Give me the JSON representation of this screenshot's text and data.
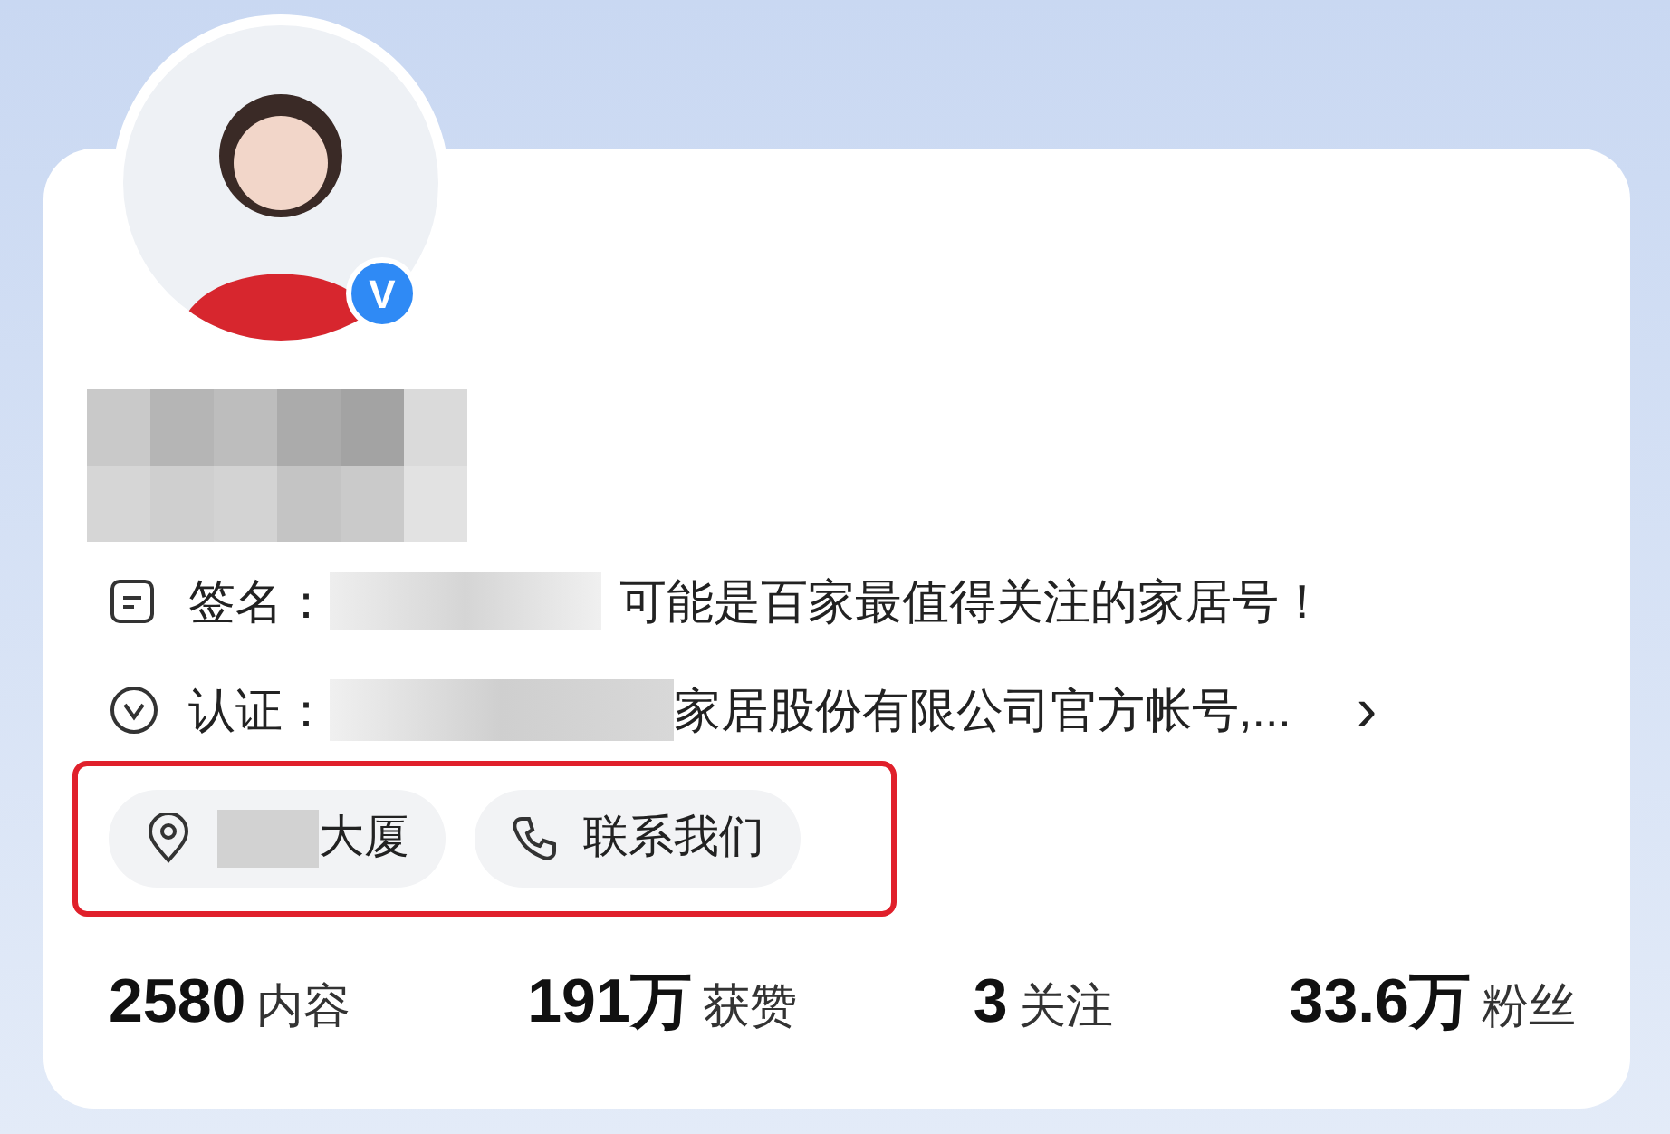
{
  "avatar": {
    "verified": true,
    "badge": "V"
  },
  "signature": {
    "label": "签名：",
    "text": "可能是百家最值得关注的家居号！"
  },
  "certification": {
    "label": "认证：",
    "text": "家居股份有限公司官方帐号,...",
    "chevron": "›"
  },
  "chips": [
    {
      "kind": "location",
      "label": "大厦"
    },
    {
      "kind": "phone",
      "label": "联系我们"
    }
  ],
  "stats": [
    {
      "value": "2580",
      "label": "内容"
    },
    {
      "value": "191万",
      "label": "获赞"
    },
    {
      "value": "3",
      "label": "关注"
    },
    {
      "value": "33.6万",
      "label": "粉丝"
    }
  ]
}
